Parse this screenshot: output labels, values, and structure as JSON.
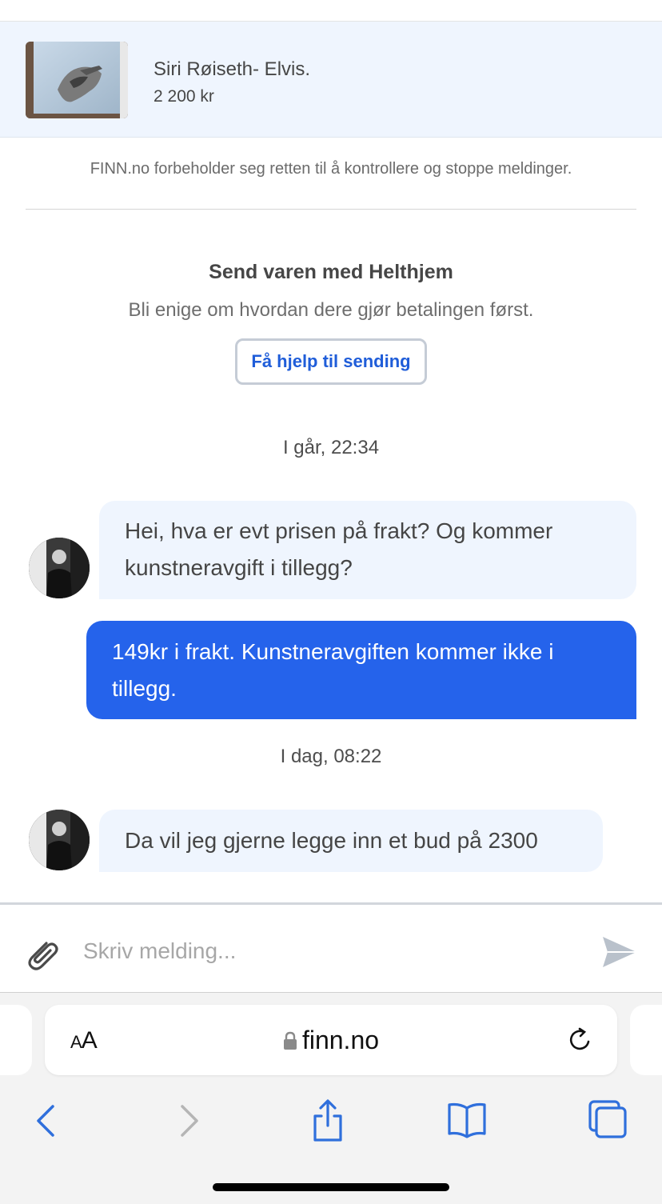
{
  "listing": {
    "title": "Siri Røiseth- Elvis.",
    "price": "2 200 kr"
  },
  "disclaimer": "FINN.no forbeholder seg retten til å kontrollere og stoppe meldinger.",
  "shipping": {
    "title": "Send varen med Helthjem",
    "subtitle": "Bli enige om hvordan dere gjør betalingen først.",
    "button_label": "Få hjelp til sending"
  },
  "conversation": {
    "timestamp_1": "I går, 22:34",
    "msg_1_line1": "Hei, hva er evt prisen på frakt? Og kommer",
    "msg_1_line2": "kunstneravgift i tillegg?",
    "msg_2_line1": "149kr i frakt. Kunstneravgiften kommer ikke i",
    "msg_2_line2": "tillegg.",
    "timestamp_2": "I dag, 08:22",
    "msg_3": "Da vil jeg gjerne legge inn et bud på 2300"
  },
  "compose": {
    "placeholder": "Skriv melding..."
  },
  "browser": {
    "text_size_label_small": "A",
    "text_size_label_large": "A",
    "url": "finn.no"
  },
  "icons": {
    "attach": "paperclip-icon",
    "send": "paper-plane-icon",
    "lock": "lock-icon",
    "reload": "reload-icon",
    "back": "chevron-left-icon",
    "forward": "chevron-right-icon",
    "share": "share-icon",
    "bookmarks": "book-icon",
    "tabs": "tabs-icon"
  },
  "colors": {
    "accent": "#2563eb",
    "bubble_incoming": "#eff5fe",
    "header_bg": "#eff5fe",
    "safari_blue": "#2f6fdc"
  }
}
